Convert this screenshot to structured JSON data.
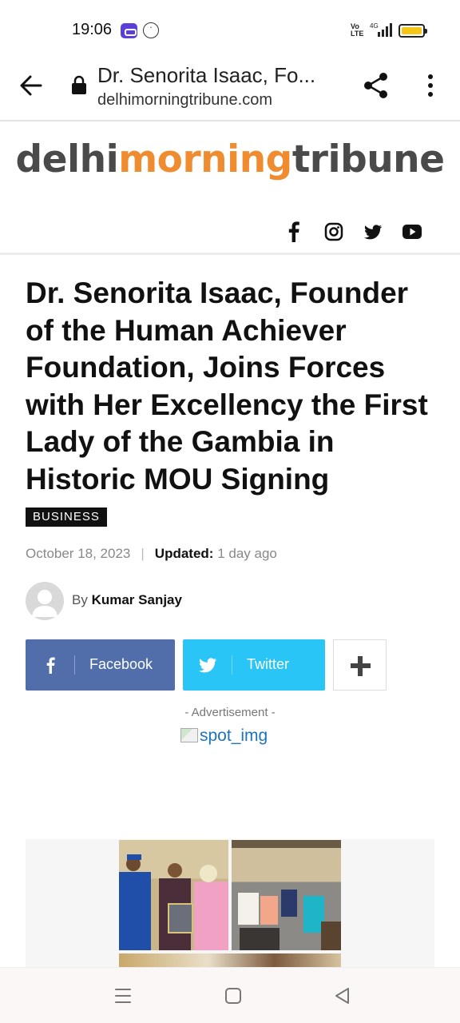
{
  "status_bar": {
    "time": "19:06",
    "volte": "Vo LTE",
    "network": "4G"
  },
  "browser": {
    "page_title": "Dr. Senorita Isaac, Fo...",
    "url": "delhimorningtribune.com",
    "icons": [
      "back-arrow-icon",
      "lock-icon",
      "share-icon",
      "more-vert-icon"
    ]
  },
  "site": {
    "logo_part1": "delhi",
    "logo_part2": "morning",
    "logo_part3": "tribune",
    "accent_color": "#f08c30",
    "social_icons": [
      "facebook-icon",
      "instagram-icon",
      "twitter-icon",
      "youtube-icon"
    ]
  },
  "article": {
    "title": "Dr. Senorita Isaac, Founder of the Human Achiever Foundation, Joins Forces with Her Excellency the First Lady of the Gambia in Historic MOU Signing",
    "category": "BUSINESS",
    "date": "October 18, 2023",
    "updated_label": "Updated:",
    "updated_value": "1 day ago",
    "by_label": "By",
    "author": "Kumar Sanjay"
  },
  "share": {
    "facebook_label": "Facebook",
    "twitter_label": "Twitter",
    "facebook_color": "#516eab",
    "twitter_color": "#29c5f6"
  },
  "ad": {
    "label": "- Advertisement -",
    "img_alt": "spot_img"
  },
  "nav": {
    "icons": [
      "menu-icon",
      "home-square-icon",
      "back-triangle-icon"
    ]
  }
}
